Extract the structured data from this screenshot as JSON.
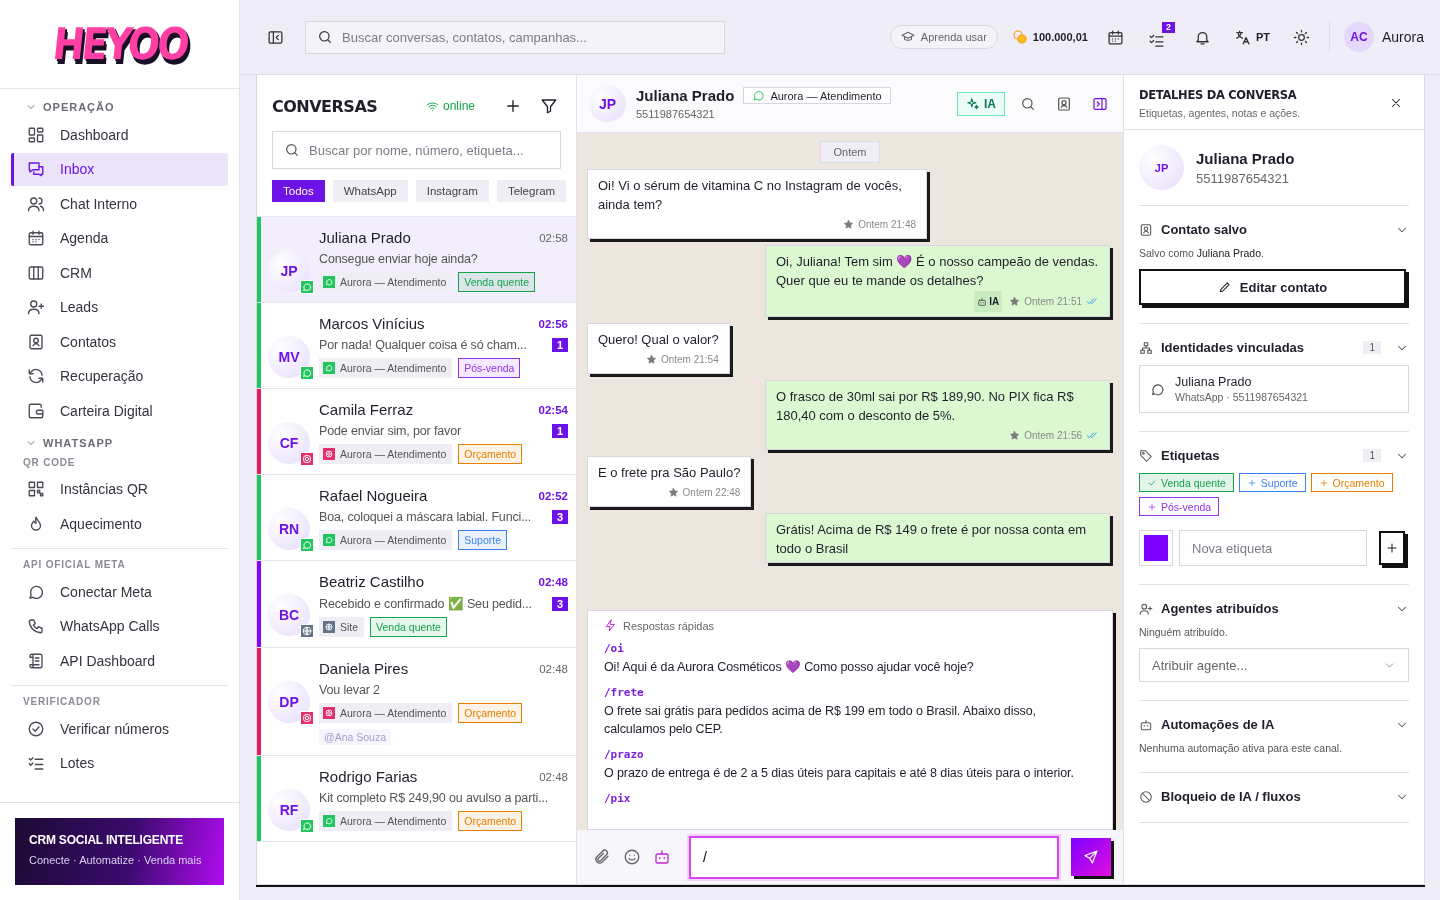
{
  "brand": {
    "logo": "HEYOO"
  },
  "sidebar": {
    "sections": [
      {
        "title": "OPERAÇÃO",
        "kind": "group",
        "expanded": true,
        "items": [
          {
            "label": "Dashboard",
            "selected": false
          },
          {
            "label": "Inbox",
            "selected": true
          },
          {
            "label": "Chat Interno",
            "selected": false
          },
          {
            "label": "Agenda",
            "selected": false
          },
          {
            "label": "CRM",
            "selected": false
          },
          {
            "label": "Leads",
            "selected": false
          },
          {
            "label": "Contatos",
            "selected": false
          },
          {
            "label": "Recuperação",
            "selected": false
          },
          {
            "label": "Carteira Digital",
            "selected": false
          }
        ]
      },
      {
        "title": "WHATSAPP",
        "kind": "group",
        "expanded": true
      },
      {
        "title": "QR CODE",
        "kind": "sub",
        "items": [
          {
            "label": "Instâncias QR",
            "selected": false
          },
          {
            "label": "Aquecimento",
            "selected": false
          }
        ]
      },
      {
        "title": "API OFICIAL META",
        "kind": "sub",
        "divider": true,
        "items": [
          {
            "label": "Conectar Meta",
            "selected": false
          },
          {
            "label": "WhatsApp Calls",
            "selected": false
          },
          {
            "label": "API Dashboard",
            "selected": false
          }
        ]
      },
      {
        "title": "VERIFICADOR",
        "kind": "sub",
        "divider": true,
        "items": [
          {
            "label": "Verificar números",
            "selected": false
          },
          {
            "label": "Lotes",
            "selected": false
          }
        ]
      }
    ],
    "promo": {
      "title": "CRM SOCIAL INTELIGENTE",
      "subtitle": "Conecte · Automatize · Venda mais"
    }
  },
  "topbar": {
    "search_placeholder": "Buscar conversas, contatos, campanhas...",
    "learn_button": "Aprenda usar",
    "balance": "100.000,01",
    "tasks_badge": "2",
    "language": "PT",
    "user": {
      "initials": "AC",
      "name": "Aurora"
    }
  },
  "conversations": {
    "title": "CONVERSAS",
    "status": "online",
    "search_placeholder": "Buscar por nome, número, etiqueta...",
    "filters": [
      {
        "label": "Todos",
        "selected": true
      },
      {
        "label": "WhatsApp",
        "selected": false
      },
      {
        "label": "Instagram",
        "selected": false
      },
      {
        "label": "Telegram",
        "selected": false
      }
    ],
    "items": [
      {
        "initials": "JP",
        "name": "Juliana Prado",
        "time": "02:58",
        "preview": "Consegue enviar hoje ainda?",
        "kind": "whatsapp",
        "color": "#22c55e",
        "source": "Aurora — Atendimento",
        "tag": {
          "label": "Venda quente",
          "color": "#16a34a"
        },
        "selected": true
      },
      {
        "initials": "MV",
        "name": "Marcos Vinícius",
        "time": "02:56",
        "preview": "Por nada! Qualquer coisa é só cham...",
        "unread": "1",
        "kind": "whatsapp",
        "color": "#22c55e",
        "source": "Aurora — Atendimento",
        "tag": {
          "label": "Pós-venda",
          "color": "#9333ea"
        },
        "selected": false
      },
      {
        "initials": "CF",
        "name": "Camila Ferraz",
        "time": "02:54",
        "preview": "Pode enviar sim, por favor",
        "unread": "1",
        "kind": "instagram",
        "color": "#e11d63",
        "source": "Aurora — Atendimento",
        "tag": {
          "label": "Orçamento",
          "color": "#e67e00"
        },
        "selected": false
      },
      {
        "initials": "RN",
        "name": "Rafael Nogueira",
        "time": "02:52",
        "preview": "Boa, coloquei a máscara labial. Funci...",
        "unread": "3",
        "kind": "whatsapp",
        "color": "#22c55e",
        "source": "Aurora — Atendimento",
        "tag": {
          "label": "Suporte",
          "color": "#3b82f6"
        },
        "selected": false
      },
      {
        "initials": "BC",
        "name": "Beatriz Castilho",
        "time": "02:48",
        "preview": "Recebido e confirmado ✅ Seu pedid...",
        "unread": "3",
        "kind": "site",
        "color": "#8b00ff",
        "source": "Site",
        "tag": {
          "label": "Venda quente",
          "color": "#16a34a"
        },
        "selected": false
      },
      {
        "initials": "DP",
        "name": "Daniela Pires",
        "time": "02:48",
        "preview": "Vou levar 2",
        "kind": "instagram",
        "color": "#e11d63",
        "source": "Aurora — Atendimento",
        "tag": {
          "label": "Orçamento",
          "color": "#e67e00"
        },
        "mention": "@Ana Souza",
        "selected": false
      },
      {
        "initials": "RF",
        "name": "Rodrigo Farias",
        "time": "02:48",
        "preview": "Kit completo R$ 249,90 ou avulso a parti...",
        "kind": "whatsapp",
        "color": "#22c55e",
        "source": "Aurora — Atendimento",
        "tag": {
          "label": "Orçamento",
          "color": "#e67e00"
        },
        "selected": false
      }
    ]
  },
  "chat": {
    "contact": {
      "initials": "JP",
      "name": "Juliana Prado",
      "phone": "5511987654321",
      "channel_label": "Aurora — Atendimento"
    },
    "ai_button": "IA",
    "day_separator": "Ontem",
    "messages": [
      {
        "kind": "in",
        "text": "Oi! Vi o sérum de vitamina C no Instagram de vocês, ainda tem?",
        "time": "Ontem 21:48"
      },
      {
        "kind": "out",
        "text": "Oi, Juliana! Tem sim 💜 É o nosso campeão de vendas. Quer que eu te mande os detalhes?",
        "ai_label": "IA",
        "time": "Ontem 21:51",
        "read": true
      },
      {
        "kind": "in",
        "text": "Quero! Qual o valor?",
        "time": "Ontem 21:54"
      },
      {
        "kind": "out",
        "text": "O frasco de 30ml sai por R$ 189,90. No PIX fica R$ 180,40 com o desconto de 5%.",
        "time": "Ontem 21:56",
        "read": true
      },
      {
        "kind": "in",
        "text": "E o frete pra São Paulo?",
        "time": "Ontem 22:48"
      },
      {
        "kind": "out",
        "text": "Grátis! Acima de R$ 149 o frete é por nossa conta em todo o Brasil"
      }
    ],
    "quick_replies": {
      "title": "Respostas rápidas",
      "items": [
        {
          "shortcut": "/oi",
          "text": "Oi! Aqui é da Aurora Cosméticos 💜 Como posso ajudar você hoje?"
        },
        {
          "shortcut": "/frete",
          "text": "O frete sai grátis para pedidos acima de R$ 199 em todo o Brasil. Abaixo disso, calculamos pelo CEP."
        },
        {
          "shortcut": "/prazo",
          "text": "O prazo de entrega é de 2 a 5 dias úteis para capitais e até 8 dias úteis para o interior."
        },
        {
          "shortcut": "/pix"
        }
      ]
    },
    "composer": {
      "value": "/"
    }
  },
  "details": {
    "title": "DETALHES DA CONVERSA",
    "subtitle": "Etiquetas, agentes, notas e ações.",
    "contact": {
      "initials": "JP",
      "name": "Juliana Prado",
      "phone": "5511987654321"
    },
    "sections": [
      {
        "kind": "saved_contact",
        "title": "Contato salvo",
        "note": "Salvo como **Juliana Prado**.",
        "button": "Editar contato"
      },
      {
        "kind": "identities",
        "title": "Identidades vinculadas",
        "count": "1",
        "items": [
          {
            "name": "Juliana Prado",
            "detail": "WhatsApp · 5511987654321"
          }
        ]
      },
      {
        "kind": "tags",
        "title": "Etiquetas",
        "count": "1",
        "tags": [
          {
            "label": "Venda quente",
            "color": "#16a34a",
            "selected": true
          },
          {
            "label": "Suporte",
            "color": "#3b82f6",
            "selected": false
          },
          {
            "label": "Orçamento",
            "color": "#e67e00",
            "selected": false
          },
          {
            "label": "Pós-venda",
            "color": "#9333ea",
            "selected": false
          }
        ],
        "swatch": {
          "color": "#7c00ff"
        },
        "new_tag_placeholder": "Nova etiqueta"
      },
      {
        "kind": "agents",
        "title": "Agentes atribuídos",
        "note": "Ninguém atribuído.",
        "select_placeholder": "Atribuir agente..."
      },
      {
        "kind": "automations",
        "title": "Automações de IA",
        "note": "Nenhuma automação ativa para este canal."
      },
      {
        "kind": "block",
        "title": "Bloqueio de IA / fluxos"
      }
    ]
  }
}
